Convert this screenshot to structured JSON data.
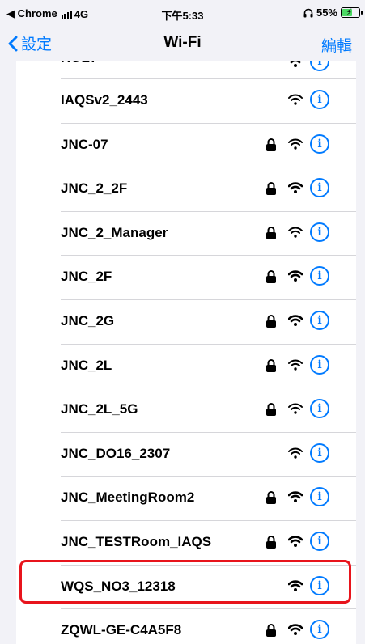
{
  "status_bar": {
    "app_back": "◀ Chrome",
    "network_type": "4G",
    "time": "下午5:33",
    "battery_percent": "55%",
    "headphones_icon": "headphones-icon"
  },
  "nav": {
    "back_label": "設定",
    "title": "Wi-Fi",
    "edit_label": "編輯"
  },
  "accent_color": "#007aff",
  "highlight_color": "#e8141c",
  "networks": [
    {
      "name": "HOLT",
      "locked": false,
      "wifi_strength": "full"
    },
    {
      "name": "IAQSv2_2443",
      "locked": false,
      "wifi_strength": "weak"
    },
    {
      "name": "JNC-07",
      "locked": true,
      "wifi_strength": "weak"
    },
    {
      "name": "JNC_2_2F",
      "locked": true,
      "wifi_strength": "full"
    },
    {
      "name": "JNC_2_Manager",
      "locked": true,
      "wifi_strength": "weak"
    },
    {
      "name": "JNC_2F",
      "locked": true,
      "wifi_strength": "full"
    },
    {
      "name": "JNC_2G",
      "locked": true,
      "wifi_strength": "full"
    },
    {
      "name": "JNC_2L",
      "locked": true,
      "wifi_strength": "weak"
    },
    {
      "name": "JNC_2L_5G",
      "locked": true,
      "wifi_strength": "weak"
    },
    {
      "name": "JNC_DO16_2307",
      "locked": false,
      "wifi_strength": "weak"
    },
    {
      "name": "JNC_MeetingRoom2",
      "locked": true,
      "wifi_strength": "full"
    },
    {
      "name": "JNC_TESTRoom_IAQS",
      "locked": true,
      "wifi_strength": "full"
    },
    {
      "name": "WQS_NO3_12318",
      "locked": false,
      "wifi_strength": "full",
      "highlighted": true
    },
    {
      "name": "ZQWL-GE-C4A5F8",
      "locked": true,
      "wifi_strength": "full"
    }
  ]
}
